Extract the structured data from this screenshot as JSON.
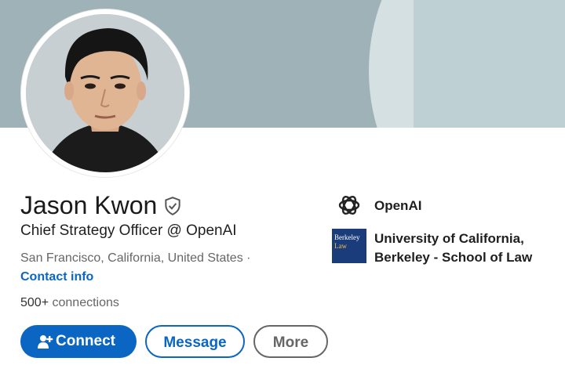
{
  "profile": {
    "name": "Jason Kwon",
    "headline": "Chief Strategy Officer @ OpenAI",
    "location": "San Francisco, California, United States ·",
    "contact_label": "Contact info",
    "connections_count": "500+",
    "connections_label": "connections"
  },
  "actions": {
    "connect_label": "Connect",
    "message_label": "Message",
    "more_label": "More"
  },
  "organizations": {
    "company": "OpenAI",
    "education_line1": "University of California,",
    "education_line2": "Berkeley - School of Law",
    "education_logo_line1": "Berkeley",
    "education_logo_line2": "Law"
  },
  "colors": {
    "accent": "#0a66c2",
    "banner": "#9fb2b7"
  },
  "icons": {
    "verified": "shield-check-icon",
    "connect": "add-person-icon",
    "company_logo": "openai-logo-icon",
    "education_logo": "berkeley-law-logo"
  }
}
